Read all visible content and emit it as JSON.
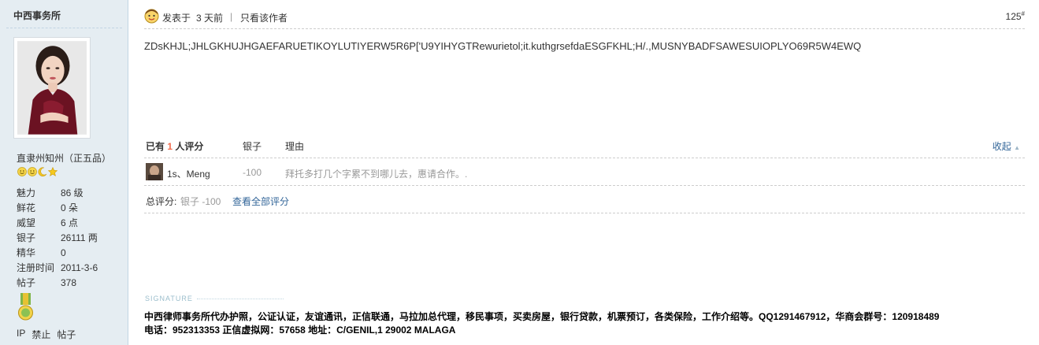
{
  "profile": {
    "name": "中西事务所",
    "rank_title": "直隶州知州（正五品）",
    "rank_icons": [
      "smiley-icon",
      "smiley-icon",
      "moon-icon",
      "star-icon"
    ],
    "stats": [
      {
        "label": "魅力",
        "value": "86 级"
      },
      {
        "label": "鲜花",
        "value": "0 朵"
      },
      {
        "label": "威望",
        "value": "6 点"
      },
      {
        "label": "银子",
        "value": "26111 两"
      },
      {
        "label": "精华",
        "value": "0"
      },
      {
        "label": "注册时间",
        "value": "2011-3-6"
      },
      {
        "label": "帖子",
        "value": "378"
      }
    ],
    "actions": [
      "IP",
      "禁止",
      "帖子"
    ]
  },
  "post": {
    "posted_label": "发表于",
    "posted_time": "3 天前",
    "divider": "|",
    "only_author": "只看该作者",
    "floor": "125",
    "floor_sup": "#",
    "body": "ZDsKHJL;JHLGKHUJHGAEFARUETIKOYLUTIYERW5R6P['U9YIHYGTRewurietol;it.kuthgrsefdaESGFKHL;H/.,MUSNYBADFSAWESUIOPLYO69R5W4EWQ"
  },
  "ratings": {
    "prefix": "已有",
    "count": "1",
    "suffix": "人评分",
    "col_silver": "银子",
    "col_reason": "理由",
    "collapse": "收起",
    "rows": [
      {
        "user": "1s、Meng",
        "score": "-100",
        "reason": "拜托多打几个字累不到哪儿去，惠请合作。."
      }
    ],
    "total_label": "总评分:",
    "total_value": "银子 -100",
    "view_all": "查看全部评分"
  },
  "signature": {
    "label": "SIGNATURE",
    "line1": "中西律师事务所代办护照，公证认证，友谊通讯，正信联通，马拉加总代理，移民事项，买卖房屋，银行贷款，机票预订，各类保险，工作介绍等。QQ1291467912，华商会群号：120918489",
    "line2": "电话：952313353 正信虚拟网：57658 地址：C/GENIL,1  29002 MALAGA"
  },
  "colors": {
    "sidebar_bg": "#e5edf2",
    "link": "#336699",
    "accent_count": "#f26c4f",
    "muted": "#999999"
  }
}
